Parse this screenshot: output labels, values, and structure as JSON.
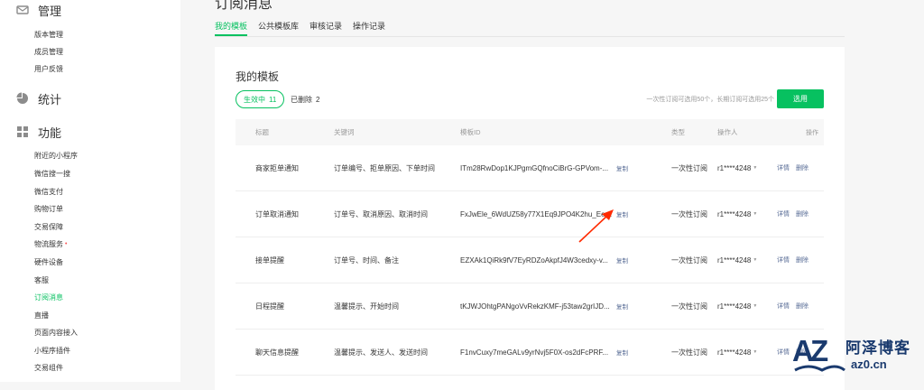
{
  "sidebar": {
    "manage": {
      "label": "管理",
      "icon": "mail-icon",
      "items": [
        "版本管理",
        "成员管理",
        "用户反馈"
      ]
    },
    "stats": {
      "label": "统计",
      "icon": "pie-chart-icon"
    },
    "features": {
      "label": "功能",
      "icon": "grid-icon",
      "items": [
        "附近的小程序",
        "微信搜一搜",
        "微信支付",
        "购物订单",
        "交易保障",
        "物流服务",
        "硬件设备",
        "客服",
        "订阅消息",
        "直播",
        "页面内容接入",
        "小程序插件",
        "交易组件"
      ],
      "active_item": "订阅消息",
      "dotted_item": "物流服务"
    }
  },
  "page": {
    "title": "订阅消息"
  },
  "tabs": [
    {
      "label": "我的模板",
      "active": true
    },
    {
      "label": "公共模板库",
      "active": false
    },
    {
      "label": "审核记录",
      "active": false
    },
    {
      "label": "操作记录",
      "active": false
    }
  ],
  "card": {
    "title": "我的模板",
    "active_label": "生效中",
    "active_count": "11",
    "deleted_label": "已删除",
    "deleted_count": "2",
    "tip": "一次性订阅可选用50个，长期订阅可选用25个",
    "select_button": "选用"
  },
  "table": {
    "headers": {
      "title": "标题",
      "keywords": "关键词",
      "template_id": "模板ID",
      "type": "类型",
      "operator": "操作人",
      "actions": "操作"
    },
    "copy_label": "复制",
    "detail_label": "详情",
    "delete_label": "删除",
    "rows": [
      {
        "title": "商家拒单通知",
        "keywords": "订单编号、拒单原因、下单时间",
        "template_id": "ITm28RwDop1KJPgmGQfnoCiBrG-GPVom-...",
        "type": "一次性订阅",
        "operator": "r1****4248"
      },
      {
        "title": "订单取消通知",
        "keywords": "订单号、取消原因、取消时间",
        "template_id": "FxJwEle_6WdUZ58y77X1Eq9JPO4K2hu_Ees...",
        "type": "一次性订阅",
        "operator": "r1****4248"
      },
      {
        "title": "接单提醒",
        "keywords": "订单号、时间、备注",
        "template_id": "EZXAk1QiRk9fV7EyRDZoAkpfJ4W3cedxy-v...",
        "type": "一次性订阅",
        "operator": "r1****4248"
      },
      {
        "title": "日程提醒",
        "keywords": "温馨提示、开始时间",
        "template_id": "tKJWJOhtgPANgoVvRekzKMF-j53taw2grIJD...",
        "type": "一次性订阅",
        "operator": "r1****4248"
      },
      {
        "title": "聊天信息提醒",
        "keywords": "温馨提示、发送人、发送时间",
        "template_id": "F1nvCuxy7meGALv9yrNvj5F0X-os2dFcPRF...",
        "type": "一次性订阅",
        "operator": "r1****4248"
      }
    ]
  },
  "watermark": {
    "brand": "阿泽博客",
    "domain": "az0.cn"
  },
  "colors": {
    "accent": "#07c160",
    "link": "#576b95",
    "annotation": "#ff2a00"
  }
}
